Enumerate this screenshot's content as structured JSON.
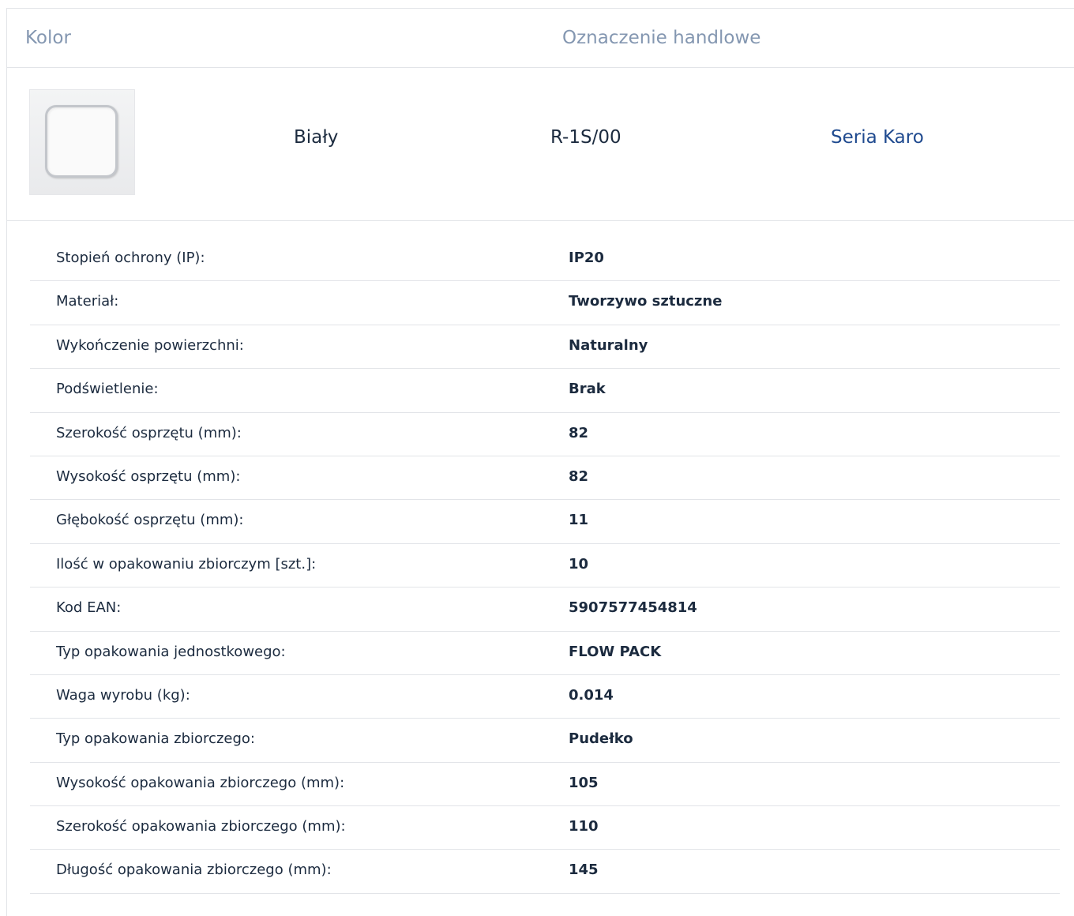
{
  "header": {
    "color_label": "Kolor",
    "trade_label": "Oznaczenie handlowe"
  },
  "product": {
    "image_icon": "white-single-frame-image",
    "color": "Biały",
    "code": "R-1S/00",
    "series_link": "Seria Karo"
  },
  "specs": [
    {
      "label": "Stopień ochrony (IP):",
      "value": "IP20"
    },
    {
      "label": "Materiał:",
      "value": "Tworzywo sztuczne"
    },
    {
      "label": "Wykończenie powierzchni:",
      "value": "Naturalny"
    },
    {
      "label": "Podświetlenie:",
      "value": "Brak"
    },
    {
      "label": "Szerokość osprzętu (mm):",
      "value": "82"
    },
    {
      "label": "Wysokość osprzętu (mm):",
      "value": "82"
    },
    {
      "label": "Głębokość osprzętu (mm):",
      "value": "11"
    },
    {
      "label": "Ilość w opakowaniu zbiorczym [szt.]:",
      "value": "10"
    },
    {
      "label": "Kod EAN:",
      "value": "5907577454814"
    },
    {
      "label": "Typ opakowania jednostkowego:",
      "value": "FLOW PACK"
    },
    {
      "label": "Waga wyrobu (kg):",
      "value": "0.014"
    },
    {
      "label": "Typ opakowania zbiorczego:",
      "value": "Pudełko"
    },
    {
      "label": "Wysokość opakowania zbiorczego (mm):",
      "value": "105"
    },
    {
      "label": "Szerokość opakowania zbiorczego (mm):",
      "value": "110"
    },
    {
      "label": "Długość opakowania zbiorczego (mm):",
      "value": "145"
    }
  ],
  "colors": {
    "header_text": "#8497b1",
    "link": "#1f4a8f",
    "text": "#1c2b3f",
    "divider": "#e2e4e8"
  }
}
